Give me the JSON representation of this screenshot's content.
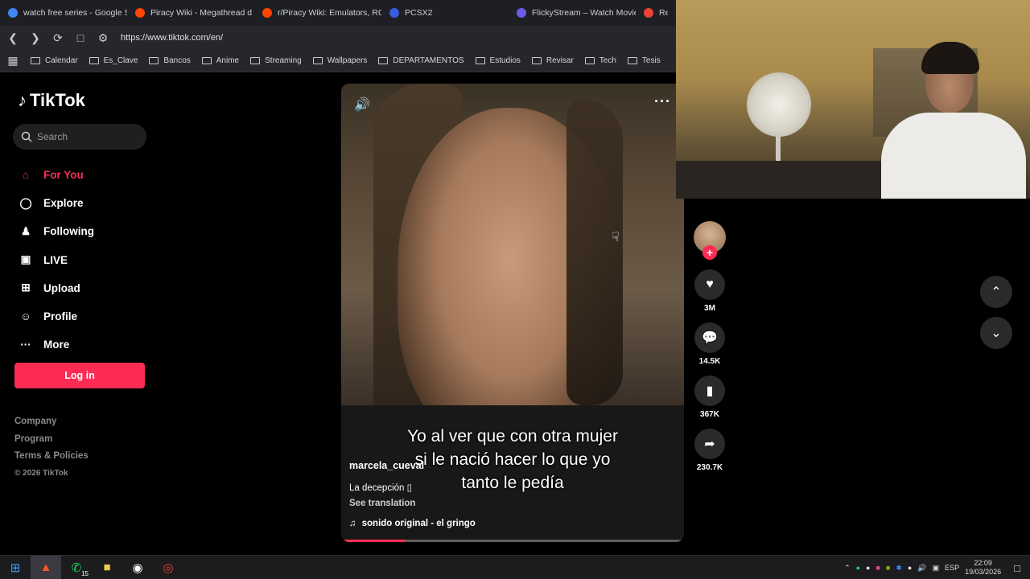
{
  "browser": {
    "tabs": [
      {
        "title": "watch free series - Google S",
        "color": "#4285f4"
      },
      {
        "title": "Piracy Wiki - Megathread d",
        "color": "#ff4500"
      },
      {
        "title": "r/Piracy Wiki: Emulators, RC",
        "color": "#ff4500"
      },
      {
        "title": "PCSX2",
        "color": "#3b5bdb"
      },
      {
        "title": "FlickyStream – Watch Movie",
        "color": "#6c5ce7"
      },
      {
        "title": "Rec",
        "color": "#ea4335"
      }
    ],
    "url": "https://www.tiktok.com/en/",
    "bookmarks": [
      "Calendar",
      "Es_Clave",
      "Bancos",
      "Anime",
      "Streaming",
      "Wallpapers",
      "DEPARTAMENTOS",
      "Estudios",
      "Revisar",
      "Tech",
      "Tesis"
    ]
  },
  "tiktok": {
    "logo": "TikTok",
    "search_placeholder": "Search",
    "nav": [
      {
        "label": "For You",
        "icon": "home-icon",
        "active": true
      },
      {
        "label": "Explore",
        "icon": "compass-icon",
        "active": false
      },
      {
        "label": "Following",
        "icon": "following-icon",
        "active": false
      },
      {
        "label": "LIVE",
        "icon": "live-icon",
        "active": false
      },
      {
        "label": "Upload",
        "icon": "upload-icon",
        "active": false
      },
      {
        "label": "Profile",
        "icon": "profile-icon",
        "active": false
      },
      {
        "label": "More",
        "icon": "more-icon",
        "active": false
      }
    ],
    "login_label": "Log in",
    "footer": {
      "company": "Company",
      "program": "Program",
      "terms": "Terms & Policies",
      "copyright": "© 2026 TikTok"
    },
    "video": {
      "caption": "Yo al ver que con otra mujer si le nació hacer lo que yo tanto le pedía",
      "author": "marcela_cueval",
      "description": "La decepción ▯",
      "see_translation": "See translation",
      "sound": "sonido original - el gringo",
      "progress": 0.18
    },
    "actions": {
      "likes": "3M",
      "comments": "14.5K",
      "saves": "367K",
      "shares": "230.7K"
    }
  },
  "taskbar": {
    "whatsapp_badge": "15",
    "language": "ESP",
    "time": "22:09",
    "date": "19/03/2026"
  },
  "colors": {
    "accent": "#fe2c55"
  }
}
